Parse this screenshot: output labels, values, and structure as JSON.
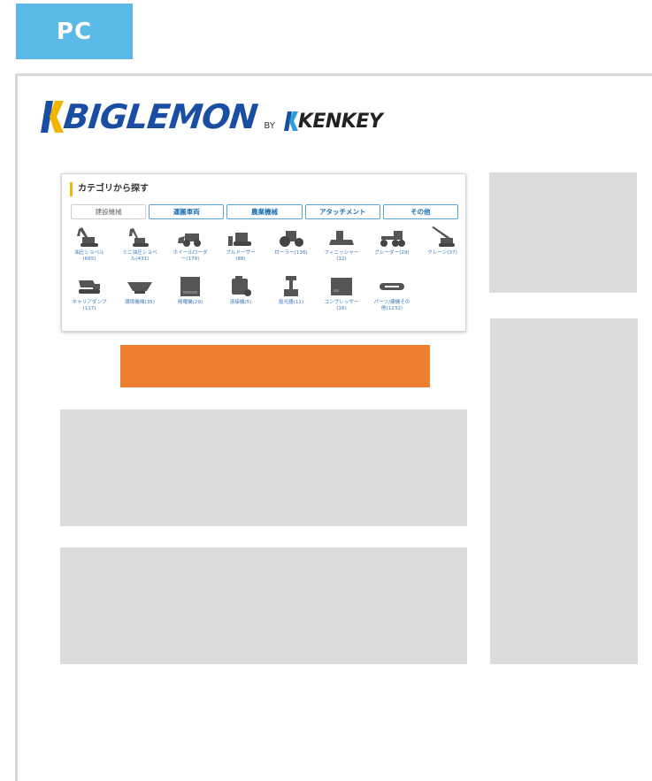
{
  "badge": {
    "label": "PC"
  },
  "logo": {
    "brand": "BIGLEMON",
    "by": "BY",
    "partner": "KENKEY"
  },
  "category_panel": {
    "title": "カテゴリから探す",
    "tabs": [
      {
        "label": "建設機械",
        "active": true
      },
      {
        "label": "運搬車両",
        "active": false
      },
      {
        "label": "農業機械",
        "active": false
      },
      {
        "label": "アタッチメント",
        "active": false
      },
      {
        "label": "その他",
        "active": false
      }
    ],
    "items": [
      {
        "label": "油圧ショベル\n(665)",
        "icon": "excavator-icon"
      },
      {
        "label": "ミニ油圧ショベ\nル(431)",
        "icon": "mini-excavator-icon"
      },
      {
        "label": "ホイールローダ\nー(179)",
        "icon": "wheel-loader-icon"
      },
      {
        "label": "ブルドーザー\n(88)",
        "icon": "bulldozer-icon"
      },
      {
        "label": "ローラー(136)",
        "icon": "roller-icon"
      },
      {
        "label": "フィニッシャー\n(12)",
        "icon": "finisher-icon"
      },
      {
        "label": "グレーダー(29)",
        "icon": "grader-icon"
      },
      {
        "label": "クレーン(37)",
        "icon": "crane-icon"
      },
      {
        "label": "キャリアダンプ\n(117)",
        "icon": "carrier-dump-icon"
      },
      {
        "label": "環境機械(35)",
        "icon": "environment-machine-icon"
      },
      {
        "label": "発電機(29)",
        "icon": "generator-icon"
      },
      {
        "label": "溶接機(5)",
        "icon": "welder-icon"
      },
      {
        "label": "投光器(11)",
        "icon": "floodlight-icon"
      },
      {
        "label": "コンプレッサー\n(16)",
        "icon": "compressor-icon"
      },
      {
        "label": "パーツ/建機その\n他(1232)",
        "icon": "parts-icon"
      }
    ]
  },
  "colors": {
    "badge": "#5bb9e8",
    "orange_button": "#ee7f31",
    "placeholder": "#dcdcdc",
    "brand_blue": "#1a4ea3",
    "brand_yellow": "#f2b400"
  }
}
